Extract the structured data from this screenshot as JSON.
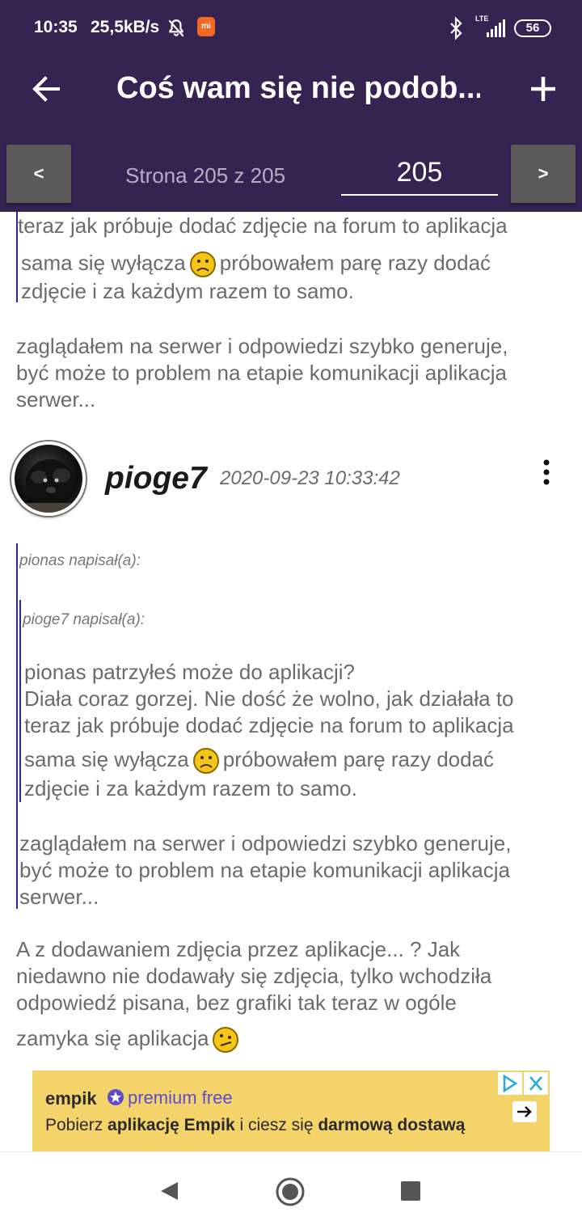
{
  "status_bar": {
    "time": "10:35",
    "speed": "25,5kB/s",
    "network": "LTE",
    "battery": "56"
  },
  "app_bar": {
    "title": "Coś wam się nie podob..."
  },
  "pager": {
    "prev_label": "<",
    "next_label": ">",
    "page_label": "Strona 205 z 205",
    "page_value": "205"
  },
  "top_quote": {
    "lines": [
      "teraz jak próbuje dodać zdjęcie na forum to aplikacja",
      "sama się wyłącza",
      "próbowałem parę razy dodać",
      "zdjęcie i za każdym razem to samo."
    ]
  },
  "top_reply": {
    "lines": [
      "zaglądałem na serwer i odpowiedzi szybko generuje,",
      "być może to problem na etapie komunikacji aplikacja",
      "serwer..."
    ]
  },
  "post": {
    "username": "pioge7",
    "date": "2020-09-23 10:33:42",
    "outer_quote_header": "pionas napisał(a):",
    "inner_quote_header": "pioge7 napisał(a):",
    "inner_quote_lines": [
      "pionas patrzyłeś może do aplikacji?",
      "Diała coraz gorzej. Nie dość że wolno, jak działała to",
      "teraz jak próbuje dodać zdjęcie na forum to aplikacja",
      "sama się wyłącza",
      "próbowałem parę razy dodać",
      "zdjęcie i za każdym razem to samo."
    ],
    "outer_quote_lines": [
      "zaglądałem na serwer i odpowiedzi szybko generuje,",
      "być może to problem na etapie komunikacji aplikacja",
      "serwer..."
    ],
    "body_lines": [
      "A z dodawaniem zdjęcia przez aplikacje... ? Jak",
      "niedawno nie dodawały się zdjęcia, tylko wchodziła",
      "odpowiedź pisana, bez grafiki tak teraz w ogóle",
      "zamyka się aplikacja"
    ]
  },
  "ad": {
    "brand": "empik",
    "tagline": "premium free",
    "text_1": "Pobierz ",
    "text_2": "aplikację Empik",
    "text_3": " i ciesz się ",
    "text_4": "darmową dostawą"
  },
  "colors": {
    "header_bg": "#362352",
    "quote_bar": "#2a2a9c",
    "ad_bg": "#f5d36b",
    "ad_premium": "#5b4bd1"
  }
}
